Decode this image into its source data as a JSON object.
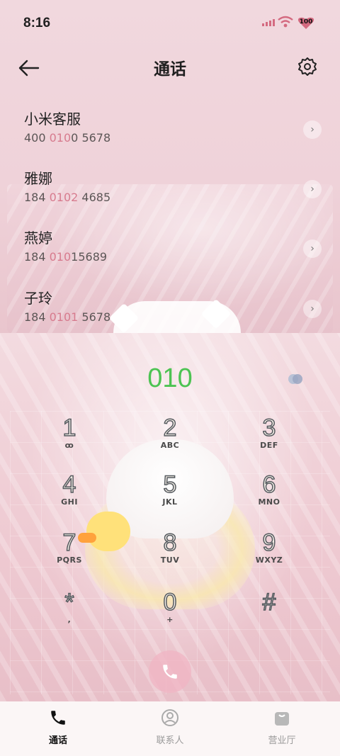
{
  "status_bar": {
    "time": "8:16",
    "battery": "100"
  },
  "header": {
    "title": "通话"
  },
  "contacts": [
    {
      "name": "小米客服",
      "num_pre": "400 ",
      "num_hl": "010",
      "num_post": "0 5678"
    },
    {
      "name": "雅娜",
      "num_pre": "184 ",
      "num_hl": "0102",
      "num_post": " 4685"
    },
    {
      "name": "燕婷",
      "num_pre": "184 ",
      "num_hl": "010",
      "num_post": "15689"
    },
    {
      "name": "子玲",
      "num_pre": "184 ",
      "num_hl": "0101",
      "num_post": " 5678"
    }
  ],
  "dialer": {
    "input": "010",
    "keys": [
      {
        "num": "1",
        "letters": "ꝏ"
      },
      {
        "num": "2",
        "letters": "ABC"
      },
      {
        "num": "3",
        "letters": "DEF"
      },
      {
        "num": "4",
        "letters": "GHI"
      },
      {
        "num": "5",
        "letters": "JKL"
      },
      {
        "num": "6",
        "letters": "MNO"
      },
      {
        "num": "7",
        "letters": "PQRS"
      },
      {
        "num": "8",
        "letters": "TUV"
      },
      {
        "num": "9",
        "letters": "WXYZ"
      },
      {
        "num": "*",
        "letters": ","
      },
      {
        "num": "0",
        "letters": "+"
      },
      {
        "num": "#",
        "letters": ""
      }
    ]
  },
  "nav": [
    {
      "label": "通话",
      "icon": "phone-icon"
    },
    {
      "label": "联系人",
      "icon": "person-icon"
    },
    {
      "label": "营业厅",
      "icon": "bag-icon"
    }
  ],
  "colors": {
    "accent_green": "#4cc352",
    "highlight_pink": "#d77b8e",
    "signal": "#d46a80"
  }
}
